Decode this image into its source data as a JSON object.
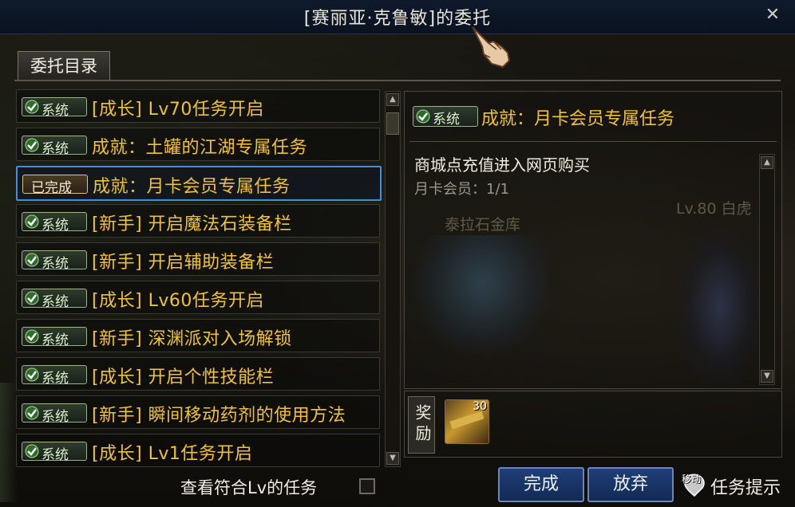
{
  "window": {
    "title": "[赛丽亚·克鲁敏]的委托",
    "close_label": "✕"
  },
  "tab": {
    "label": "委托目录"
  },
  "quests": [
    {
      "badge": "系统",
      "label": "[成长] Lv70任务开启",
      "status": "system"
    },
    {
      "badge": "系统",
      "label": "成就：土罐的江湖专属任务",
      "status": "system"
    },
    {
      "badge": "已完成",
      "label": "成就：月卡会员专属任务",
      "status": "done"
    },
    {
      "badge": "系统",
      "label": "[新手] 开启魔法石装备栏",
      "status": "system"
    },
    {
      "badge": "系统",
      "label": "[新手] 开启辅助装备栏",
      "status": "system"
    },
    {
      "badge": "系统",
      "label": "[成长] Lv60任务开启",
      "status": "system"
    },
    {
      "badge": "系统",
      "label": "[新手] 深渊派对入场解锁",
      "status": "system"
    },
    {
      "badge": "系统",
      "label": "[成长] 开启个性技能栏",
      "status": "system"
    },
    {
      "badge": "系统",
      "label": "[新手] 瞬间移动药剂的使用方法",
      "status": "system"
    },
    {
      "badge": "系统",
      "label": "[成长] Lv1任务开启",
      "status": "system"
    }
  ],
  "selected_index": 2,
  "detail": {
    "badge": "系统",
    "title": "成就：月卡会员专属任务",
    "description": "商城点充值进入网页购买",
    "progress": "月卡会员：1/1",
    "background_texts": [
      "泰拉石金库",
      "Lv.80 白虎"
    ]
  },
  "reward": {
    "label": "奖励",
    "item_count": "30"
  },
  "footer": {
    "filter_label": "查看符合Lv的任务",
    "filter_checked": false,
    "complete_label": "完成",
    "abandon_label": "放弃",
    "hint_small": "移动",
    "hint_label": "任务提示"
  },
  "colors": {
    "quest_text": "#f1c232",
    "button_blue": "#1f3f78",
    "selected_border": "#3e8fe0"
  }
}
